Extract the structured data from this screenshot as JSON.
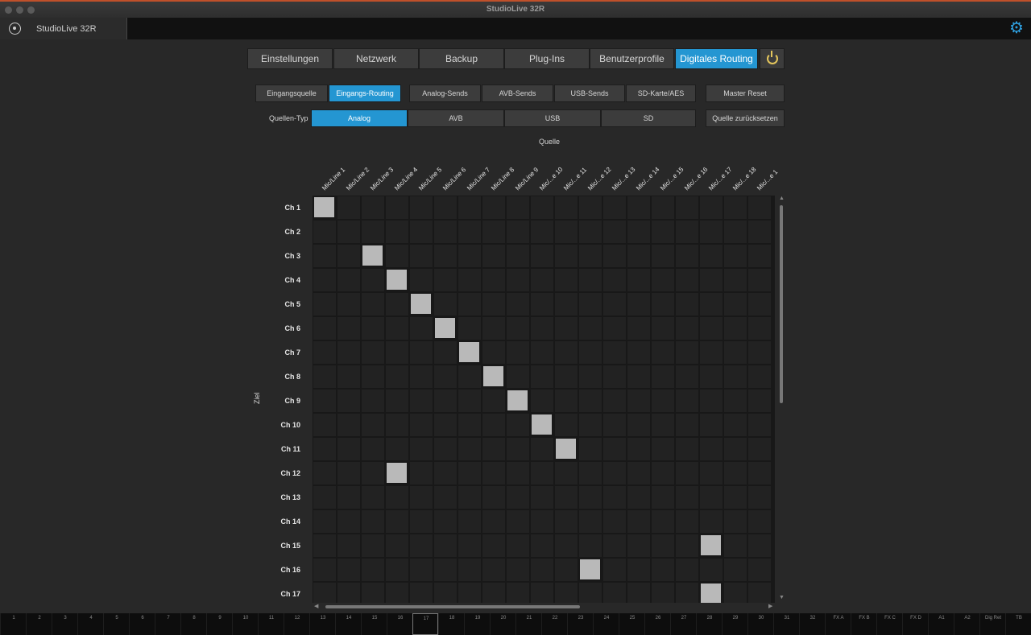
{
  "window": {
    "title": "StudioLive 32R"
  },
  "device_tab": {
    "label": "StudioLive 32R"
  },
  "nav_tabs": [
    {
      "label": "Einstellungen",
      "active": false
    },
    {
      "label": "Netzwerk",
      "active": false
    },
    {
      "label": "Backup",
      "active": false
    },
    {
      "label": "Plug-Ins",
      "active": false
    },
    {
      "label": "Benutzerprofile",
      "active": false
    },
    {
      "label": "Digitales Routing",
      "active": true
    }
  ],
  "sub_tabs": [
    {
      "label": "Eingangsquelle",
      "active": false
    },
    {
      "label": "Eingangs-Routing",
      "active": true
    },
    {
      "label": "Analog-Sends",
      "active": false
    },
    {
      "label": "AVB-Sends",
      "active": false
    },
    {
      "label": "USB-Sends",
      "active": false
    },
    {
      "label": "SD-Karte/AES",
      "active": false
    }
  ],
  "master_reset": "Master Reset",
  "source_type": {
    "label": "Quellen-Typ",
    "options": [
      {
        "label": "Analog",
        "active": true
      },
      {
        "label": "AVB",
        "active": false
      },
      {
        "label": "USB",
        "active": false
      },
      {
        "label": "SD",
        "active": false
      }
    ]
  },
  "reset_source": "Quelle zurücksetzen",
  "matrix": {
    "source_label": "Quelle",
    "target_label": "Ziel",
    "columns": [
      "Mic/Line 1",
      "Mic/Line 2",
      "Mic/Line 3",
      "Mic/Line 4",
      "Mic/Line 5",
      "Mic/Line 6",
      "Mic/Line 7",
      "Mic/Line 8",
      "Mic/Line 9",
      "Mic/...e 10",
      "Mic/...e 11",
      "Mic/...e 12",
      "Mic/...e 13",
      "Mic/...e 14",
      "Mic/...e 15",
      "Mic/...e 16",
      "Mic/...e 17",
      "Mic/...e 18",
      "Mic/...e 1"
    ],
    "rows": [
      "Ch 1",
      "Ch 2",
      "Ch 3",
      "Ch 4",
      "Ch 5",
      "Ch 6",
      "Ch 7",
      "Ch 8",
      "Ch 9",
      "Ch 10",
      "Ch 11",
      "Ch 12",
      "Ch 13",
      "Ch 14",
      "Ch 15",
      "Ch 16",
      "Ch 17"
    ],
    "active": [
      [
        0,
        0
      ],
      [
        2,
        2
      ],
      [
        3,
        3
      ],
      [
        4,
        4
      ],
      [
        5,
        5
      ],
      [
        6,
        6
      ],
      [
        7,
        7
      ],
      [
        8,
        8
      ],
      [
        9,
        9
      ],
      [
        10,
        10
      ],
      [
        11,
        3
      ],
      [
        14,
        16
      ],
      [
        15,
        11
      ],
      [
        16,
        16
      ]
    ]
  },
  "fader_strip": [
    "1",
    "2",
    "3",
    "4",
    "5",
    "6",
    "7",
    "8",
    "9",
    "10",
    "11",
    "12",
    "13",
    "14",
    "15",
    "16",
    "17",
    "18",
    "19",
    "20",
    "21",
    "22",
    "23",
    "24",
    "25",
    "26",
    "27",
    "28",
    "29",
    "30",
    "31",
    "32",
    "FX A",
    "FX B",
    "FX C",
    "FX D",
    "A1",
    "A2",
    "Dig Ret",
    "TB"
  ],
  "fader_selected": "17",
  "colors": {
    "accent": "#2496d2",
    "power": "#e4c65c",
    "active_cell": "#b9b9b9"
  }
}
